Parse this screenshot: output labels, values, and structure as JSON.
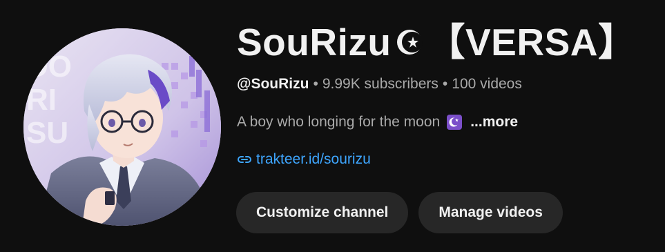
{
  "channel": {
    "name_prefix": "SouRizu",
    "name_badge_icon": "star-crescent-icon",
    "name_suffix": "【VERSA】",
    "handle": "@SouRizu",
    "subscribers": "9.99K subscribers",
    "videos": "100 videos",
    "separator": "•",
    "description": "A boy who longing for the moon",
    "description_emoji_icon": "crescent-moon-emoji",
    "more_label": "...more",
    "link_icon": "link-icon",
    "link_text": "trakteer.id/sourizu"
  },
  "actions": {
    "customize_label": "Customize channel",
    "manage_label": "Manage videos"
  },
  "colors": {
    "background": "#0f0f0f",
    "text_primary": "#f1f1f1",
    "text_secondary": "#aaaaaa",
    "link": "#3ea6ff",
    "button_bg": "#272727",
    "emoji_bg": "#7b4fc9"
  },
  "avatar": {
    "alt": "channel-avatar"
  }
}
